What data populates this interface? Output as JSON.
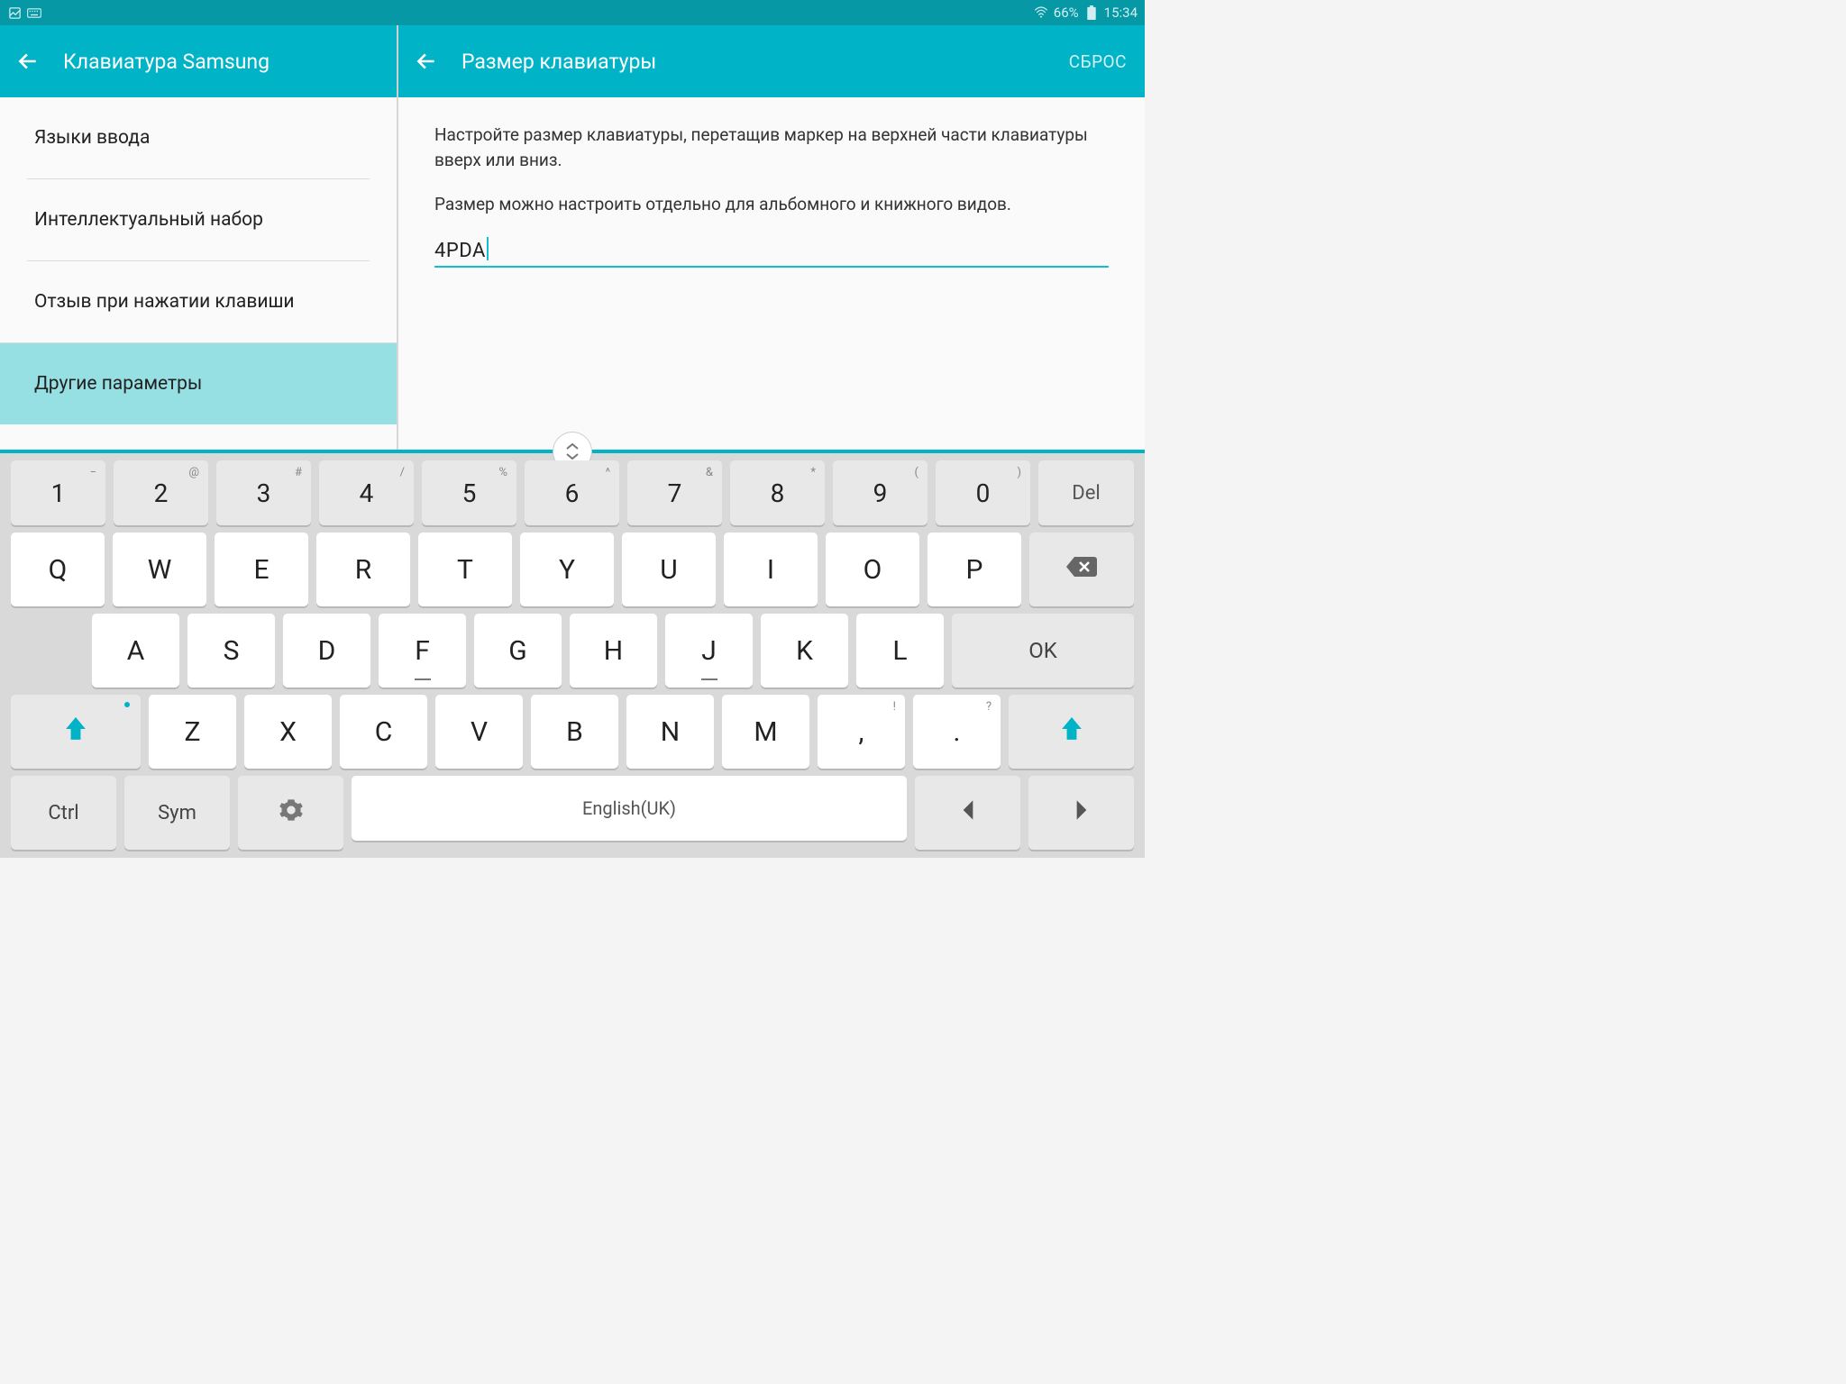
{
  "statusbar": {
    "battery": "66%",
    "time": "15:34"
  },
  "header_left": {
    "title": "Клавиатура Samsung"
  },
  "header_right": {
    "title": "Размер клавиатуры",
    "reset": "СБРОС"
  },
  "sidebar": {
    "items": [
      {
        "label": "Языки ввода"
      },
      {
        "label": "Интеллектуальный набор"
      },
      {
        "label": "Отзыв при нажатии клавиши"
      },
      {
        "label": "Другие параметры"
      }
    ]
  },
  "content": {
    "desc1": "Настройте размер клавиатуры, перетащив маркер на верхней части клавиатуры вверх или вниз.",
    "desc2": "Размер можно настроить отдельно для альбомного и книжного видов.",
    "input_value": "4PDA"
  },
  "keyboard": {
    "num_row": [
      {
        "main": "1",
        "sup": "−"
      },
      {
        "main": "2",
        "sup": "@"
      },
      {
        "main": "3",
        "sup": "#"
      },
      {
        "main": "4",
        "sup": "/"
      },
      {
        "main": "5",
        "sup": "%"
      },
      {
        "main": "6",
        "sup": "^"
      },
      {
        "main": "7",
        "sup": "&"
      },
      {
        "main": "8",
        "sup": "*"
      },
      {
        "main": "9",
        "sup": "("
      },
      {
        "main": "0",
        "sup": ")"
      }
    ],
    "del": "Del",
    "q_row": [
      "Q",
      "W",
      "E",
      "R",
      "T",
      "Y",
      "U",
      "I",
      "O",
      "P"
    ],
    "a_row": [
      "A",
      "S",
      "D",
      "F",
      "G",
      "H",
      "J",
      "K",
      "L"
    ],
    "ok": "OK",
    "z_row": [
      "Z",
      "X",
      "C",
      "V",
      "B",
      "N",
      "M"
    ],
    "comma": {
      "main": ",",
      "sup": "!"
    },
    "period": {
      "main": ".",
      "sup": "?"
    },
    "ctrl": "Ctrl",
    "sym": "Sym",
    "space": "English(UK)"
  }
}
